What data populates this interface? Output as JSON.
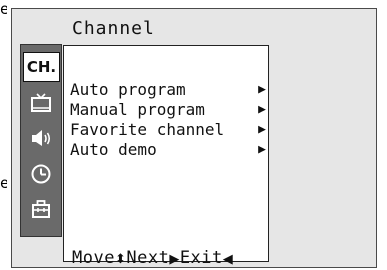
{
  "menu": {
    "title": "Channel",
    "categories": [
      {
        "id": "channel",
        "label": "CH.",
        "icon": "channel-label",
        "active": true
      },
      {
        "id": "picture",
        "icon": "tv-icon",
        "active": false
      },
      {
        "id": "sound",
        "icon": "speaker-icon",
        "active": false
      },
      {
        "id": "time",
        "icon": "clock-icon",
        "active": false
      },
      {
        "id": "setup",
        "icon": "toolbox-icon",
        "active": false
      }
    ],
    "items": [
      {
        "label": "Auto program",
        "arrow": "▶"
      },
      {
        "label": "Manual program",
        "arrow": "▶"
      },
      {
        "label": "Favorite channel",
        "arrow": "▶"
      },
      {
        "label": "Auto demo",
        "arrow": "▶"
      }
    ]
  },
  "footer": {
    "move_label": "Move",
    "move_glyph": "⬍",
    "next_label": "Next",
    "next_glyph": "▶",
    "exit_label": "Exit",
    "exit_glyph": "◀"
  }
}
